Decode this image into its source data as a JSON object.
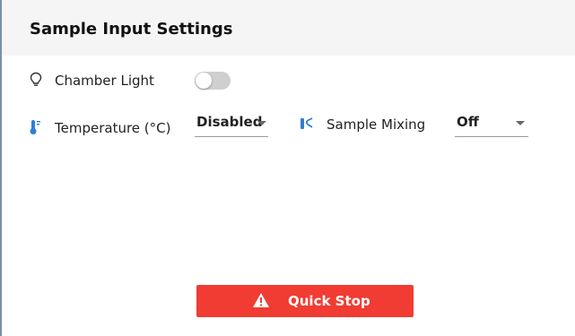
{
  "panel": {
    "title": "Sample Input Settings"
  },
  "chamber_light": {
    "label": "Chamber Light",
    "enabled": false,
    "icon": "lightbulb-icon"
  },
  "temperature": {
    "label": "Temperature (°C)",
    "value": "Disabled",
    "icon": "thermometer-icon"
  },
  "sample_mixing": {
    "label": "Sample Mixing",
    "value": "Off",
    "icon": "mixing-icon"
  },
  "quick_stop": {
    "label": "Quick Stop",
    "icon": "warning-icon"
  },
  "colors": {
    "accent_blue": "#2f7fd3",
    "stop_red": "#f03c32",
    "header_bg": "#f5f5f5"
  }
}
